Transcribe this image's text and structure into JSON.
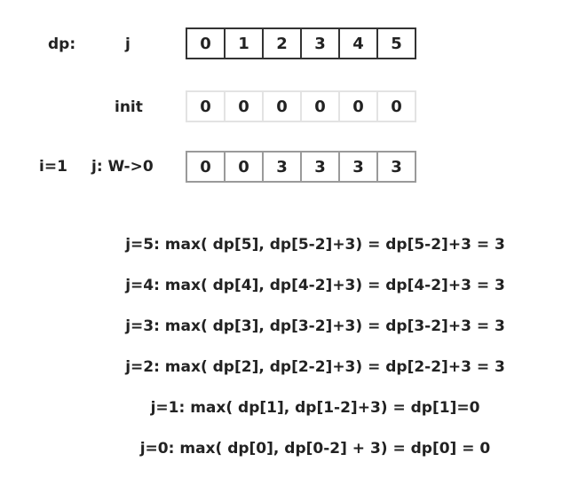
{
  "labels": {
    "dp": "dp:",
    "j": "j",
    "init": "init",
    "i": "i=1",
    "j_dir": "j: W->0"
  },
  "rows": {
    "header": [
      "0",
      "1",
      "2",
      "3",
      "4",
      "5"
    ],
    "init": [
      "0",
      "0",
      "0",
      "0",
      "0",
      "0"
    ],
    "step": [
      "0",
      "0",
      "3",
      "3",
      "3",
      "3"
    ]
  },
  "equations": [
    "j=5: max( dp[5],  dp[5-2]+3) = dp[5-2]+3 = 3",
    "j=4: max( dp[4],  dp[4-2]+3) = dp[4-2]+3 = 3",
    "j=3: max( dp[3],  dp[3-2]+3) = dp[3-2]+3 = 3",
    "j=2: max( dp[2], dp[2-2]+3) = dp[2-2]+3 = 3",
    "j=1: max( dp[1], dp[1-2]+3) = dp[1]=0",
    "j=0: max( dp[0], dp[0-2] + 3) = dp[0] = 0"
  ]
}
